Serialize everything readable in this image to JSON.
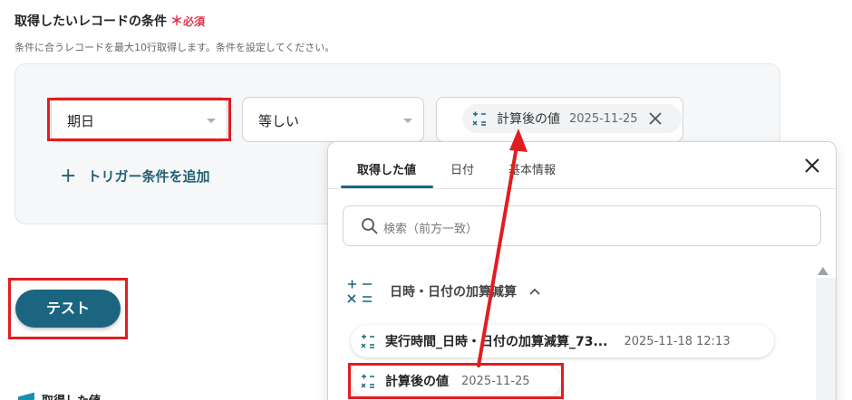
{
  "section": {
    "title": "取得したいレコードの条件",
    "required_mark": "＊",
    "required_text": "必須",
    "description": "条件に合うレコードを最大10行取得します。条件を設定してください。"
  },
  "condition": {
    "field_value": "期日",
    "operator_value": "等しい",
    "value_chip": {
      "icon": "calc-icon",
      "label": "計算後の値",
      "date": "2025-11-25"
    },
    "add_label": "トリガー条件を追加"
  },
  "test_button": "テスト",
  "cut_label": "取得した値",
  "dropdown": {
    "tabs": [
      "取得した値",
      "日付",
      "基本情報"
    ],
    "active_tab": "取得した値",
    "search_placeholder": "検索（前方一致）",
    "group": {
      "label": "日時・日付の加算減算",
      "expanded": true,
      "items": [
        {
          "label": "実行時間_日時・日付の加算減算_73...",
          "date": "2025-11-18 12:13"
        },
        {
          "label": "計算後の値",
          "date": "2025-11-25"
        }
      ]
    }
  },
  "colors": {
    "accent": "#1b6580",
    "required": "#e0334a",
    "highlight": "#e11d21"
  }
}
